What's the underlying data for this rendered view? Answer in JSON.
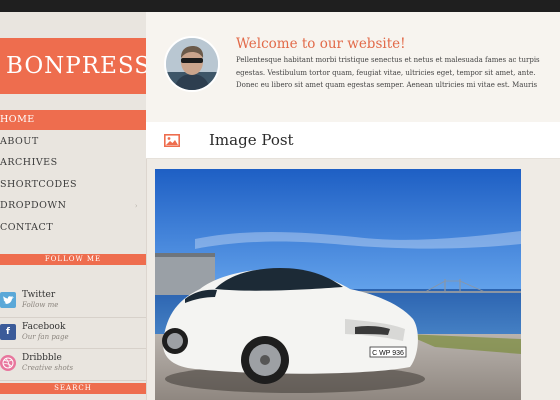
{
  "site": {
    "logo_text": "BONPRESS",
    "accent_color": "#ee6d4e"
  },
  "nav": {
    "items": [
      {
        "label": "HOME",
        "active": true
      },
      {
        "label": "ABOUT",
        "active": false
      },
      {
        "label": "ARCHIVES",
        "active": false
      },
      {
        "label": "SHORTCODES",
        "active": false
      },
      {
        "label": "DROPDOWN",
        "active": false,
        "has_submenu": true
      },
      {
        "label": "CONTACT",
        "active": false
      }
    ]
  },
  "sidebar": {
    "follow_heading": "FOLLOW ME",
    "search_heading": "SEARCH",
    "social": [
      {
        "name": "Twitter",
        "sub": "Follow me",
        "icon": "twitter-icon",
        "color": "#5aa8d8"
      },
      {
        "name": "Facebook",
        "sub": "Our fan page",
        "icon": "facebook-icon",
        "color": "#3b5b99"
      },
      {
        "name": "Dribbble",
        "sub": "Creative shots",
        "icon": "dribbble-icon",
        "color": "#e8769d"
      }
    ]
  },
  "welcome": {
    "title": "Welcome to our website!",
    "text": "Pellentesque habitant morbi tristique senectus et netus et malesuada fames ac turpis egestas. Vestibulum tortor quam, feugiat vitae, ultricies eget, tempor sit amet, ante. Donec eu libero sit amet quam egestas semper. Aenean ultricies mi vitae est. Mauris placerat eleifend leo."
  },
  "post": {
    "type_icon": "image-icon",
    "title": "Image Post",
    "plate_text": "C WP 936"
  }
}
